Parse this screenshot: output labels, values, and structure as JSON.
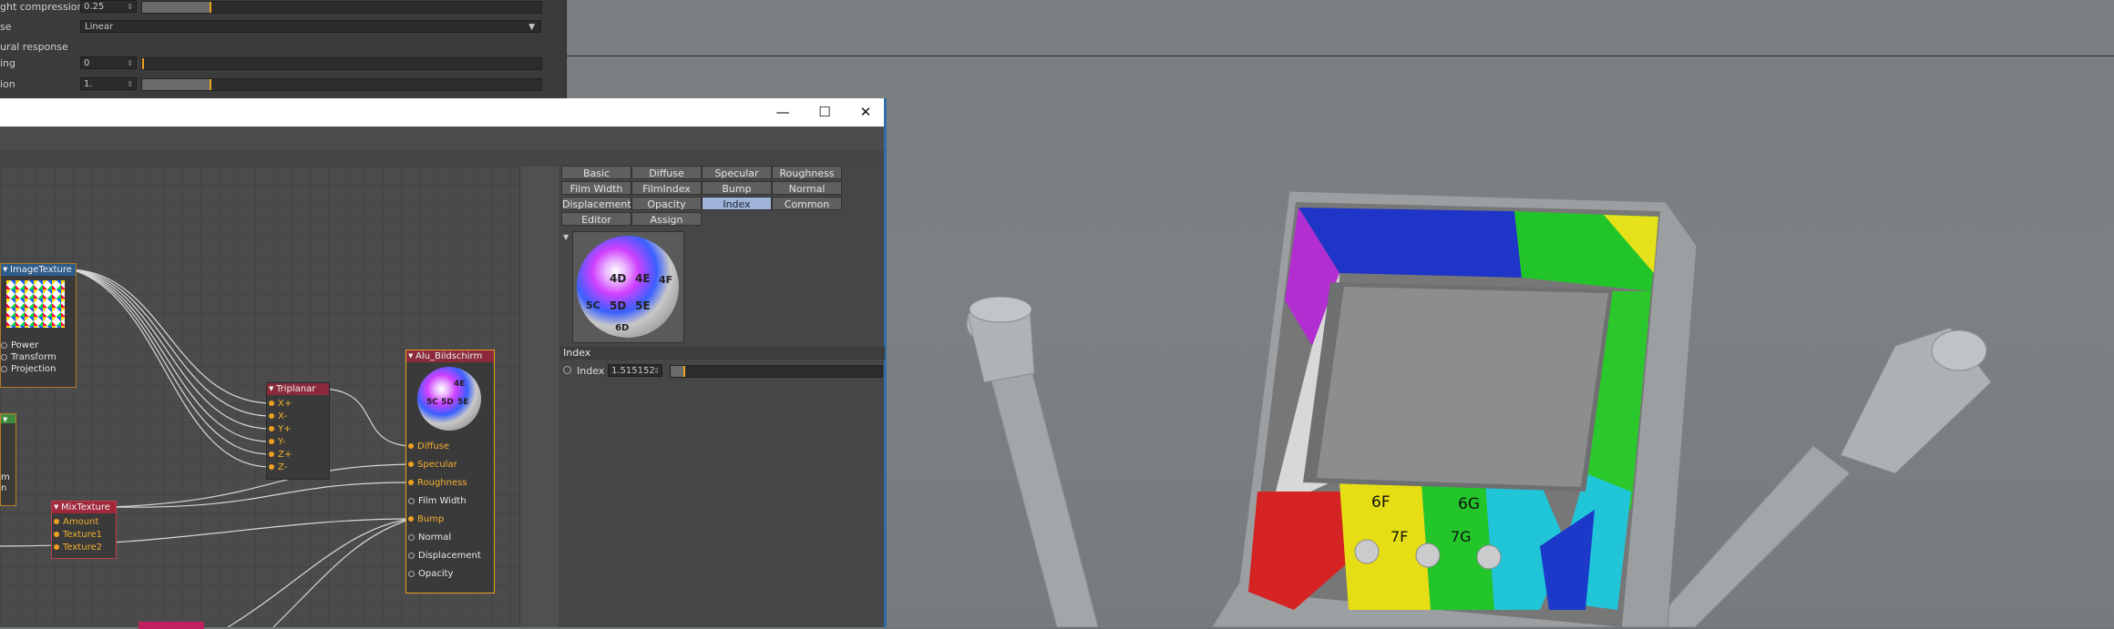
{
  "settings": {
    "rows": [
      {
        "label": "ght compression",
        "value": "0.25",
        "fill": 0.17,
        "mark": 0.17
      },
      {
        "label": "se",
        "dropdown": "Linear"
      },
      {
        "label": "ural response"
      },
      {
        "label": "ing",
        "value": "0",
        "fill": 0.0,
        "mark": 0.0
      },
      {
        "label": "ion",
        "value": "1.",
        "fill": 0.17,
        "mark": 0.17
      }
    ]
  },
  "window": {
    "controls": {
      "minimize": "—",
      "maximize": "☐",
      "close": "✕"
    }
  },
  "tabs": [
    {
      "label": "Basic"
    },
    {
      "label": "Diffuse"
    },
    {
      "label": "Specular"
    },
    {
      "label": "Roughness"
    },
    {
      "label": "Film Width"
    },
    {
      "label": "FilmIndex"
    },
    {
      "label": "Bump"
    },
    {
      "label": "Normal"
    },
    {
      "label": "Displacement"
    },
    {
      "label": "Opacity"
    },
    {
      "label": "Index",
      "active": true
    },
    {
      "label": "Common"
    },
    {
      "label": "Editor"
    },
    {
      "label": "Assign"
    }
  ],
  "preview": {
    "cells": [
      "4D",
      "4E",
      "4F",
      "5C",
      "5D",
      "5E",
      "6D"
    ]
  },
  "index_section": {
    "title": "Index",
    "param_label": "Index",
    "value": "1.515152",
    "fill": 0.06
  },
  "nodes": {
    "image_texture": {
      "title": "ImageTexture",
      "ports": [
        "Power",
        "Transform",
        "Projection"
      ]
    },
    "triplanar": {
      "title": "Triplanar",
      "ports": [
        "X+",
        "X-",
        "Y+",
        "Y-",
        "Z+",
        "Z-"
      ]
    },
    "mix_texture": {
      "title": "MixTexture",
      "ports": [
        "Amount",
        "Texture1",
        "Texture2"
      ]
    },
    "alu": {
      "title": "Alu_Bildschirm",
      "preview_cells": [
        "4E",
        "5C",
        "5D",
        "5E"
      ],
      "ports": [
        {
          "label": "Diffuse",
          "on": true
        },
        {
          "label": "Specular",
          "on": true
        },
        {
          "label": "Roughness",
          "on": true
        },
        {
          "label": "Film Width",
          "on": false
        },
        {
          "label": "Bump",
          "on": true
        },
        {
          "label": "Normal",
          "on": false
        },
        {
          "label": "Displacement",
          "on": false
        },
        {
          "label": "Opacity",
          "on": false
        }
      ]
    },
    "left_partial": {
      "ports": [
        "m",
        "n"
      ]
    }
  },
  "model": {
    "screen_labels": [
      "6F",
      "6G",
      "7F",
      "7G"
    ]
  }
}
